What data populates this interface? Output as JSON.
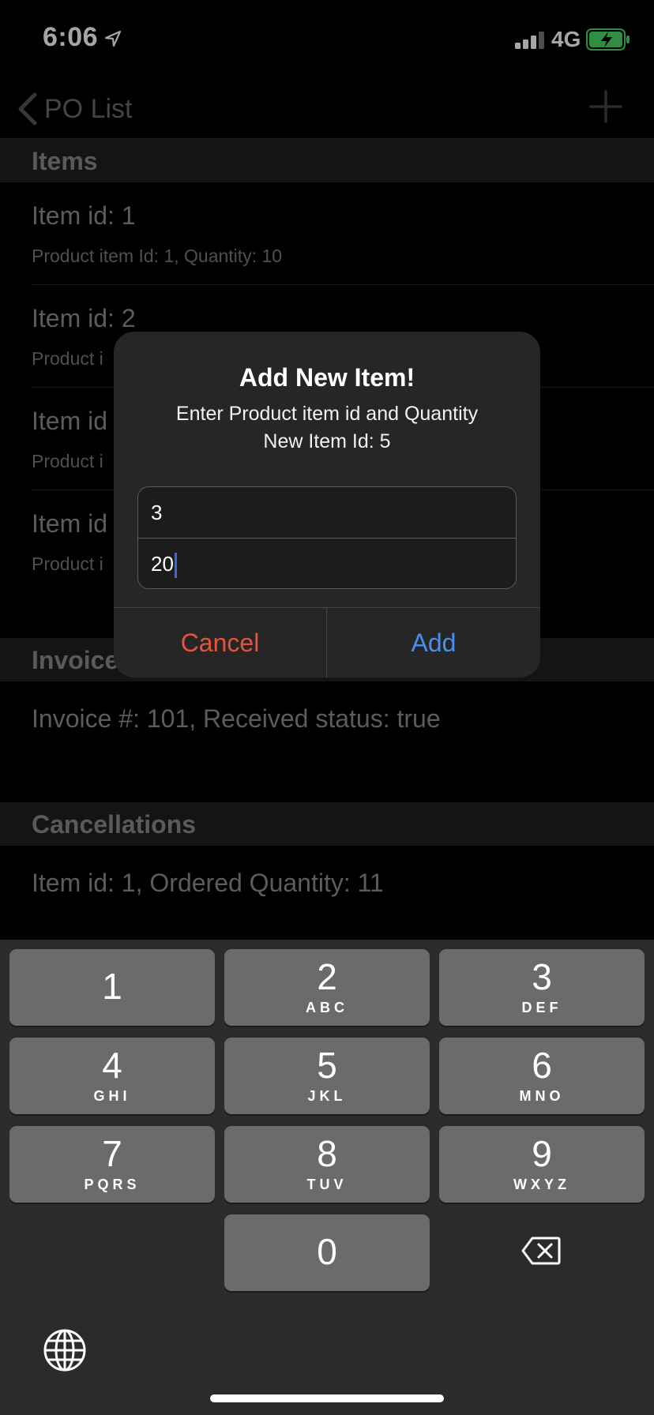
{
  "status_bar": {
    "time": "6:06",
    "network": "4G"
  },
  "nav": {
    "back_label": "PO List"
  },
  "sections": {
    "items_header": "Items",
    "invoice_header": "Invoice",
    "cancellations_header": "Cancellations"
  },
  "items": [
    {
      "title": "Item id: 1",
      "subtitle": "Product item Id: 1, Quantity: 10"
    },
    {
      "title": "Item id: 2",
      "subtitle": "Product i"
    },
    {
      "title": "Item id",
      "subtitle": "Product i"
    },
    {
      "title": "Item id",
      "subtitle": "Product i"
    }
  ],
  "invoice": {
    "text": "Invoice #: 101,    Received status: true"
  },
  "cancellations": {
    "text": "Item id: 1, Ordered Quantity: 11"
  },
  "alert": {
    "title": "Add New Item!",
    "message_line1": "Enter Product item id and Quantity",
    "message_line2": "New Item Id: 5",
    "field1_value": "3",
    "field2_value": "20",
    "cancel_label": "Cancel",
    "add_label": "Add"
  },
  "keyboard": {
    "keys": [
      {
        "num": "1",
        "letters": ""
      },
      {
        "num": "2",
        "letters": "ABC"
      },
      {
        "num": "3",
        "letters": "DEF"
      },
      {
        "num": "4",
        "letters": "GHI"
      },
      {
        "num": "5",
        "letters": "JKL"
      },
      {
        "num": "6",
        "letters": "MNO"
      },
      {
        "num": "7",
        "letters": "PQRS"
      },
      {
        "num": "8",
        "letters": "TUV"
      },
      {
        "num": "9",
        "letters": "WXYZ"
      },
      {
        "num": "0",
        "letters": ""
      }
    ]
  },
  "icons": {
    "location": "location-arrow-icon",
    "signal": "cellular-signal-icon",
    "battery": "battery-charging-icon",
    "back": "chevron-left-icon",
    "add": "plus-icon",
    "backspace": "backspace-icon",
    "globe": "globe-icon"
  },
  "colors": {
    "cancel": "#e5533f",
    "add": "#4a8ef0",
    "battery_fill": "#4cd964",
    "caret": "#3a66e0"
  }
}
